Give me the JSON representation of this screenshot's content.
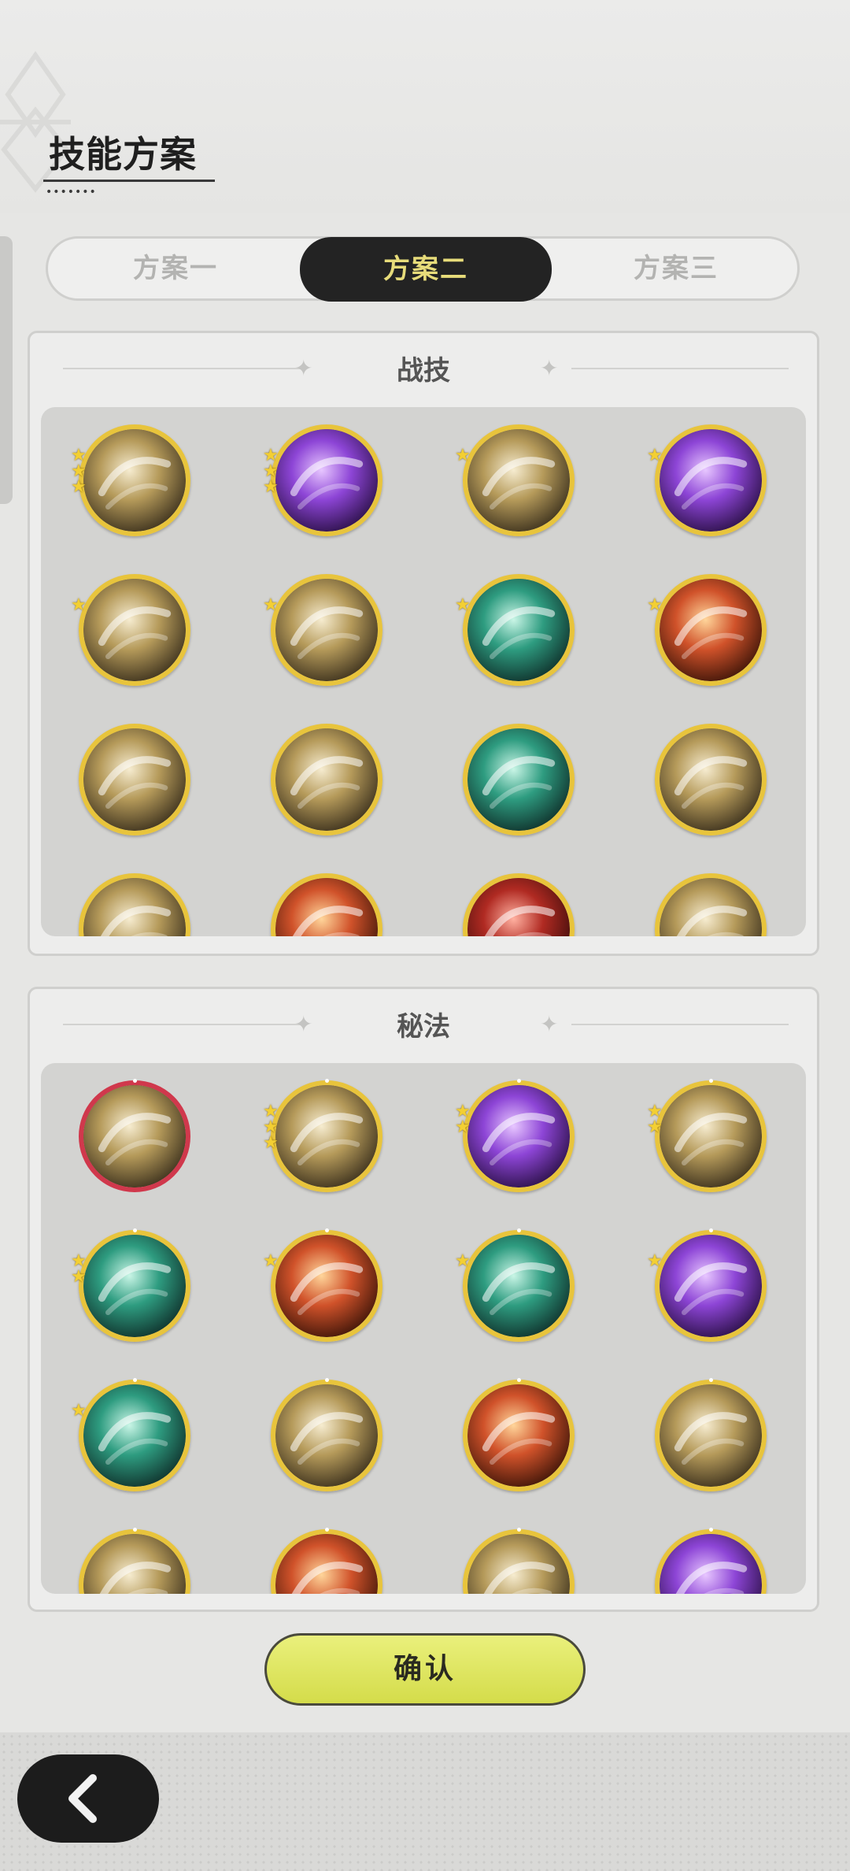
{
  "header": {
    "title": "技能方案"
  },
  "tabs": [
    {
      "label": "方案一",
      "active": false
    },
    {
      "label": "方案二",
      "active": true
    },
    {
      "label": "方案三",
      "active": false
    }
  ],
  "sections": {
    "combat": {
      "title": "战技"
    },
    "secret": {
      "title": "秘法"
    }
  },
  "combat_icons": [
    {
      "icon": "golden-swirl-slash-icon",
      "stars": 3,
      "theme": "gold"
    },
    {
      "icon": "purple-heart-burst-icon",
      "stars": 3,
      "theme": "purple"
    },
    {
      "icon": "silver-spiral-icon",
      "stars": 1,
      "theme": "gold"
    },
    {
      "icon": "purple-claw-icon",
      "stars": 1,
      "theme": "purple"
    },
    {
      "icon": "dash-strike-icon",
      "stars": 1,
      "theme": "gold"
    },
    {
      "icon": "sword-slash-icon",
      "stars": 1,
      "theme": "gold"
    },
    {
      "icon": "teal-greatsword-icon",
      "stars": 1,
      "theme": "teal"
    },
    {
      "icon": "fire-ring-icon",
      "stars": 1,
      "theme": "fire"
    },
    {
      "icon": "wind-slash-icon",
      "stars": 0,
      "theme": "gold"
    },
    {
      "icon": "whirlwind-icon",
      "stars": 0,
      "theme": "gold"
    },
    {
      "icon": "crescent-wave-icon",
      "stars": 0,
      "theme": "teal"
    },
    {
      "icon": "cross-strike-icon",
      "stars": 0,
      "theme": "gold"
    },
    {
      "icon": "skill-icon-13",
      "stars": 0,
      "theme": "gold"
    },
    {
      "icon": "skill-icon-14",
      "stars": 0,
      "theme": "fire"
    },
    {
      "icon": "skill-icon-15",
      "stars": 0,
      "theme": "red"
    },
    {
      "icon": "skill-icon-16",
      "stars": 0,
      "theme": "gold"
    }
  ],
  "secret_icons": [
    {
      "icon": "maple-leaf-icon",
      "stars": 0,
      "theme": "gold",
      "ring": "red"
    },
    {
      "icon": "dagger-icon",
      "stars": 3,
      "theme": "gold"
    },
    {
      "icon": "purple-flame-icon",
      "stars": 2,
      "theme": "purple"
    },
    {
      "icon": "armor-icon",
      "stars": 2,
      "theme": "gold"
    },
    {
      "icon": "heart-heal-icon",
      "stars": 2,
      "theme": "teal"
    },
    {
      "icon": "red-fist-icon",
      "stars": 1,
      "theme": "fire"
    },
    {
      "icon": "heal-circle-icon",
      "stars": 1,
      "theme": "teal"
    },
    {
      "icon": "purple-aura-icon",
      "stars": 1,
      "theme": "purple"
    },
    {
      "icon": "teal-blade-icon",
      "stars": 1,
      "theme": "teal"
    },
    {
      "icon": "golden-guardian-icon",
      "stars": 0,
      "theme": "gold"
    },
    {
      "icon": "red-armor-icon",
      "stars": 0,
      "theme": "fire"
    },
    {
      "icon": "beast-icon",
      "stars": 0,
      "theme": "gold"
    },
    {
      "icon": "skill-icon-13b",
      "stars": 0,
      "theme": "gold"
    },
    {
      "icon": "skill-icon-14b",
      "stars": 0,
      "theme": "fire"
    },
    {
      "icon": "skill-icon-15b",
      "stars": 0,
      "theme": "gold"
    },
    {
      "icon": "skill-icon-16b",
      "stars": 0,
      "theme": "purple"
    }
  ],
  "confirm": {
    "label": "确认"
  },
  "colors": {
    "tab_active_bg": "#232323",
    "tab_active_text": "#e7dc7a",
    "ring_gold": "#e8c43c",
    "ring_red": "#d0384c",
    "confirm_bg": "#dfe65e",
    "star": "#f3cf33"
  }
}
